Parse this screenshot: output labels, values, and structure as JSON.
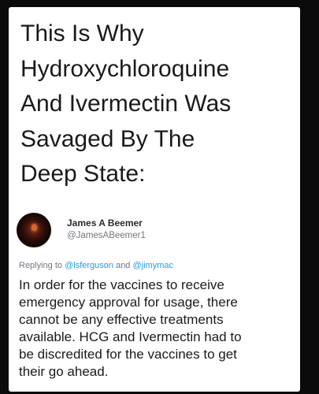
{
  "headline": "This Is Why\nHydroxychloroquine\nAnd Ivermectin Was\nSavaged By The\nDeep State:",
  "tweet": {
    "display_name": "James A Beemer",
    "handle": "@JamesABeemer1",
    "replying_prefix": "Replying to ",
    "mention_1": "@lsferguson",
    "replying_and": " and ",
    "mention_2": "@jimymac",
    "text": "In order for the vaccines to receive\nemergency approval for usage, there\ncannot be any effective treatments\navailable. HCG and Ivermectin had to\nbe discredited for the vaccines to get\ntheir go ahead."
  },
  "colors": {
    "background": "#0b0b0b",
    "card": "#ffffff",
    "mention": "#1d9bf0",
    "muted": "#707780"
  }
}
